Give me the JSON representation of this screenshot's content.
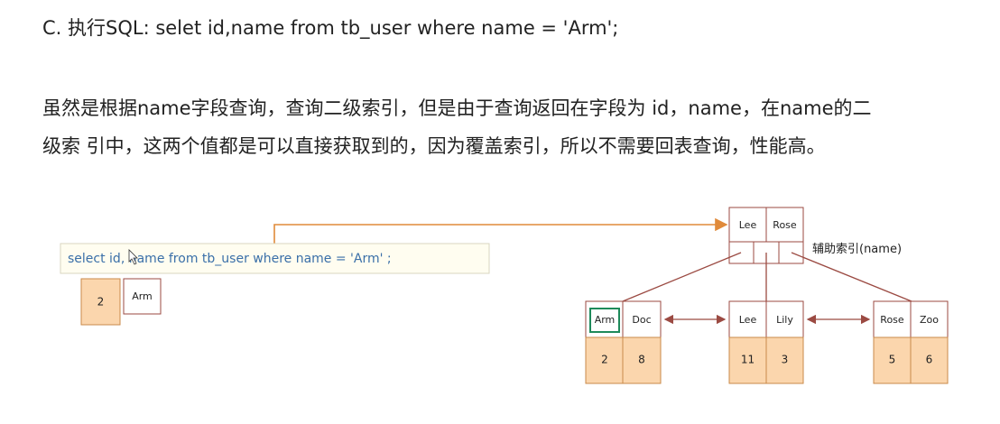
{
  "heading": "C. 执行SQL:  selet id,name from tb_user where name = 'Arm';",
  "paragraph": {
    "line1": "虽然是根据name字段查询，查询二级索引，但是由于查询返回在字段为 id，name，在name的二",
    "line2": "级索 引中，这两个值都是可以直接获取到的，因为覆盖索引，所以不需要回表查询，性能高。"
  },
  "diagram": {
    "sql": "select id, name  from  tb_user  where  name = 'Arm' ;",
    "result": {
      "id": "2",
      "name": "Arm"
    },
    "index_label": "辅助索引(name)",
    "root": {
      "keys": [
        "Lee",
        "Rose"
      ]
    },
    "leaves": [
      {
        "keys": [
          "Arm",
          "Doc"
        ],
        "ids": [
          "2",
          "8"
        ]
      },
      {
        "keys": [
          "Lee",
          "Lily"
        ],
        "ids": [
          "11",
          "3"
        ]
      },
      {
        "keys": [
          "Rose",
          "Zoo"
        ],
        "ids": [
          "5",
          "6"
        ]
      }
    ],
    "colors": {
      "arrow": "#9b4a42",
      "orange_line": "#e08a3a",
      "id_fill": "#fbd6ad",
      "sql_box_fill": "#fffdf0",
      "highlight": "#1e8a5a"
    }
  }
}
